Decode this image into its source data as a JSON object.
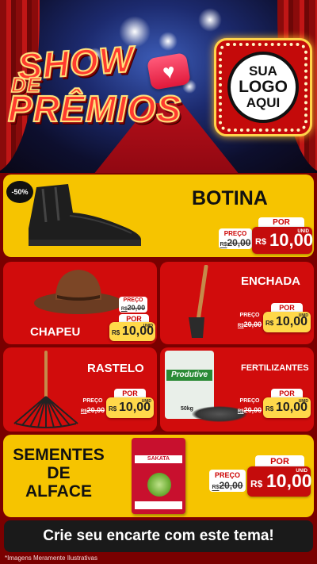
{
  "hero": {
    "title_line1": "SHOW",
    "title_line2": "DE",
    "title_line3": "PRÊMIOS",
    "logo_line1": "SUA",
    "logo_line2": "LOGO",
    "logo_line3": "AQUI"
  },
  "colors": {
    "yellow": "#f6c400",
    "red": "#d10c0c",
    "price_red": "#c40c0c",
    "price_gold": "#ffd84a"
  },
  "products": [
    {
      "name": "BOTINA",
      "badge": "-50%",
      "old_label": "PREÇO",
      "old_value": "20,00",
      "old_prefix": "R$",
      "new_label": "POR",
      "currency": "R$",
      "new_value": "10,00",
      "unit": "UNID"
    },
    {
      "name": "CHAPEU",
      "old_label": "PREÇO",
      "old_value": "20,00",
      "old_prefix": "R$",
      "new_label": "POR",
      "currency": "R$",
      "new_value": "10,00",
      "unit": "UNID"
    },
    {
      "name": "ENCHADA",
      "old_label": "PREÇO",
      "old_value": "20,00",
      "old_prefix": "R$",
      "new_label": "POR",
      "currency": "R$",
      "new_value": "10,00",
      "unit": "UNID"
    },
    {
      "name": "RASTELO",
      "old_label": "PREÇO",
      "old_value": "20,00",
      "old_prefix": "R$",
      "new_label": "POR",
      "currency": "R$",
      "new_value": "10,00",
      "unit": "UNID"
    },
    {
      "name": "FERTILIZANTES",
      "old_label": "PREÇO",
      "old_value": "20,00",
      "old_prefix": "R$",
      "new_label": "POR",
      "currency": "R$",
      "new_value": "10,00",
      "unit": "UNID",
      "package_brand": "Produtive",
      "package_weight": "50kg"
    },
    {
      "name_line1": "SEMENTES",
      "name_line2": "DE",
      "name_line3": "ALFACE",
      "old_label": "PREÇO",
      "old_value": "20,00",
      "old_prefix": "R$",
      "new_label": "POR",
      "currency": "R$",
      "new_value": "10,00",
      "unit": "UNID",
      "package_brand": "SAKATA"
    }
  ],
  "banner": "Crie seu encarte com este tema!",
  "disclaimer": "*Imagens Meramente Ilustrativas"
}
